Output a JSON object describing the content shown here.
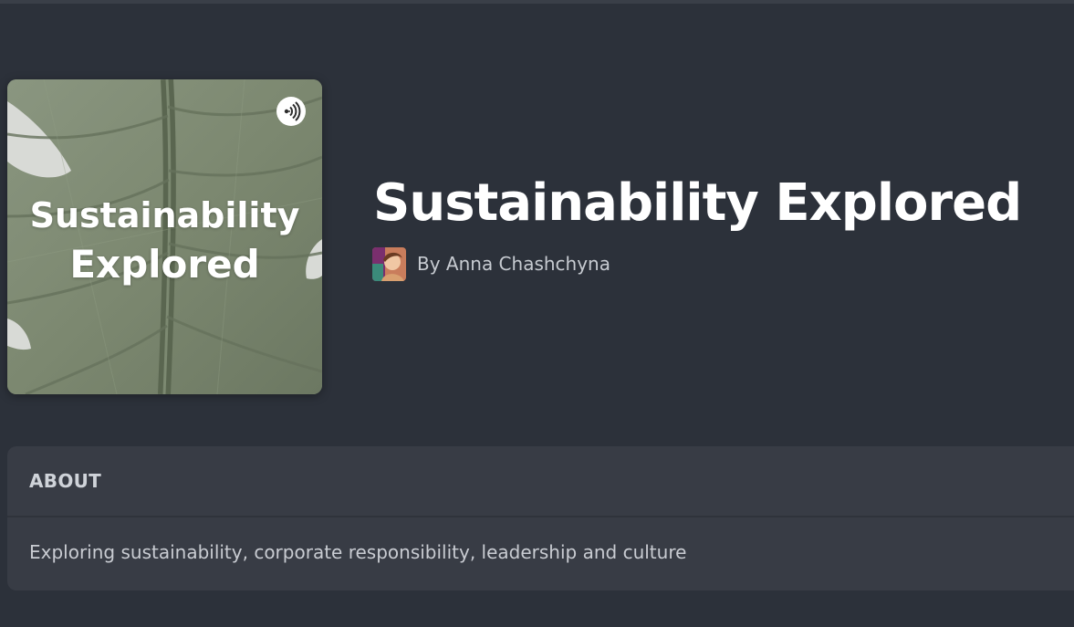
{
  "podcast": {
    "cover_title_line1": "Sustainability",
    "cover_title_line2": "Explored",
    "badge_icon": "anchor-podcast-icon",
    "title": "Sustainability Explored",
    "author": "By Anna Chashchyna"
  },
  "about": {
    "heading": "ABOUT",
    "description": "Exploring sustainability, corporate responsibility, leadership and culture"
  },
  "colors": {
    "background": "#2c313a",
    "card": "#383c45",
    "title_text": "#ffffff",
    "muted_text": "#c7cbd1",
    "cover_green": "#7f8a74"
  }
}
